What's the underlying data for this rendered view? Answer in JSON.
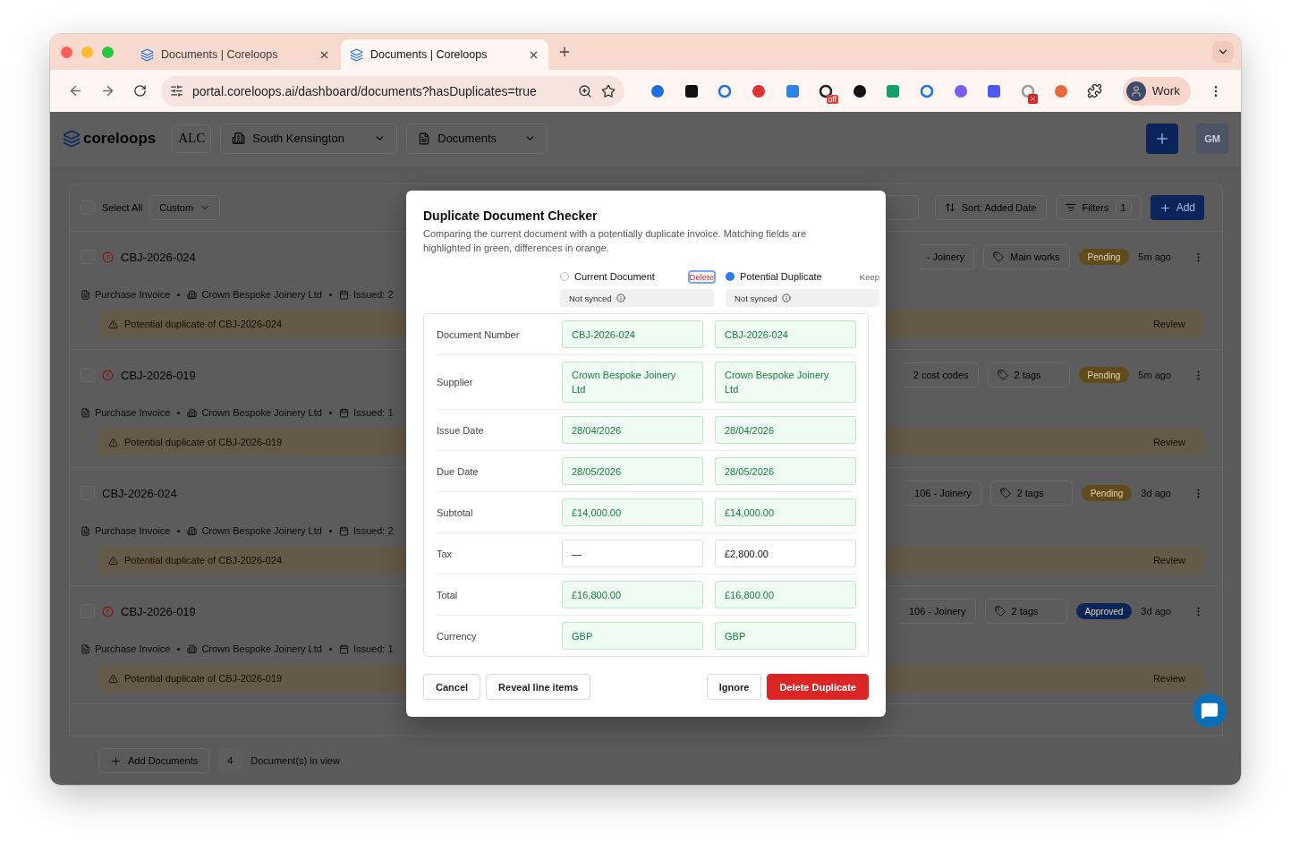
{
  "browser": {
    "tabs": [
      {
        "title": "Documents | Coreloops",
        "selected": false
      },
      {
        "title": "Documents | Coreloops",
        "selected": true
      }
    ],
    "url": "portal.coreloops.ai/dashboard/documents?hasDuplicates=true",
    "extension_badge": "off",
    "profile": "Work"
  },
  "header": {
    "logo": "coreloops",
    "org_logo": "ALC",
    "site": "South Kensington",
    "section": "Documents",
    "avatar": "GM"
  },
  "toolbar": {
    "select_all": "Select All",
    "checked": false,
    "view": "Custom",
    "sort": "Sort: Added Date",
    "filters": "Filters",
    "filter_count": "1",
    "add": "Add"
  },
  "documents": [
    {
      "number": "CBJ-2026-024",
      "checked": false,
      "flagged": true,
      "type": "Purchase Invoice",
      "supplier": "Crown Bespoke Joinery Ltd",
      "issued": "Issued: 2",
      "cost_code": "- Joinery",
      "tags": "Main works",
      "status": "Pending",
      "color": "#5f4b1c",
      "age": "5m ago",
      "warning": "Potential duplicate of CBJ-2026-024",
      "action": "Review"
    },
    {
      "number": "CBJ-2026-019",
      "checked": false,
      "flagged": true,
      "type": "Purchase Invoice",
      "supplier": "Crown Bespoke Joinery Ltd",
      "issued": "Issued: 1",
      "cost_code": "2 cost codes",
      "tags": "2 tags",
      "status": "Pending",
      "color": "#5f4b1c",
      "age": "5m ago",
      "warning": "Potential duplicate of CBJ-2026-019",
      "action": "Review"
    },
    {
      "number": "CBJ-2026-024",
      "checked": false,
      "flagged": false,
      "type": "Purchase Invoice",
      "supplier": "Crown Bespoke Joinery Ltd",
      "issued": "Issued: 2",
      "cost_code": "106 - Joinery",
      "tags": "2 tags",
      "status": "Pending",
      "color": "#5f4b1c",
      "age": "3d ago",
      "warning": "Potential duplicate of CBJ-2026-024",
      "action": "Review"
    },
    {
      "number": "CBJ-2026-019",
      "checked": false,
      "flagged": true,
      "type": "Purchase Invoice",
      "supplier": "Crown Bespoke Joinery Ltd",
      "issued": "Issued: 1",
      "cost_code": "106 - Joinery",
      "tags": "2 tags",
      "status": "Approved",
      "color": "#0b2459",
      "age": "3d ago",
      "warning": "Potential duplicate of CBJ-2026-019",
      "action": "Review"
    }
  ],
  "footer": {
    "add": "Add Documents",
    "count": "4",
    "label": "Document(s) in view"
  },
  "modal": {
    "title": "Duplicate Document Checker",
    "description": "Comparing the current document with a potentially duplicate invoice. Matching fields are highlighted in green, differences in orange.",
    "columns": [
      {
        "label": "Current Document",
        "selected": false,
        "action": "Delete",
        "destructive": true,
        "focused": true,
        "sync": "Not synced"
      },
      {
        "label": "Potential Duplicate",
        "selected": true,
        "action": "Keep",
        "destructive": false,
        "focused": false,
        "sync": "Not synced"
      }
    ],
    "fields": [
      {
        "label": "Document Number",
        "values": [
          "CBJ-2026-024",
          "CBJ-2026-024"
        ],
        "match": true
      },
      {
        "label": "Supplier",
        "values": [
          "Crown Bespoke Joinery Ltd",
          "Crown Bespoke Joinery Ltd"
        ],
        "match": true
      },
      {
        "label": "Issue Date",
        "values": [
          "28/04/2026",
          "28/04/2026"
        ],
        "match": true
      },
      {
        "label": "Due Date",
        "values": [
          "28/05/2026",
          "28/05/2026"
        ],
        "match": true
      },
      {
        "label": "Subtotal",
        "values": [
          "£14,000.00",
          "£14,000.00"
        ],
        "match": true
      },
      {
        "label": "Tax",
        "values": [
          "—",
          "£2,800.00"
        ],
        "match": false
      },
      {
        "label": "Total",
        "values": [
          "£16,800.00",
          "£16,800.00"
        ],
        "match": true
      },
      {
        "label": "Currency",
        "values": [
          "GBP",
          "GBP"
        ],
        "match": true
      }
    ],
    "buttons_left": [
      {
        "label": "Cancel",
        "kind": "secondary"
      },
      {
        "label": "Reveal line items",
        "kind": "secondary"
      }
    ],
    "buttons_right": [
      {
        "label": "Ignore",
        "kind": "secondary"
      },
      {
        "label": "Delete Duplicate",
        "kind": "danger"
      }
    ]
  }
}
